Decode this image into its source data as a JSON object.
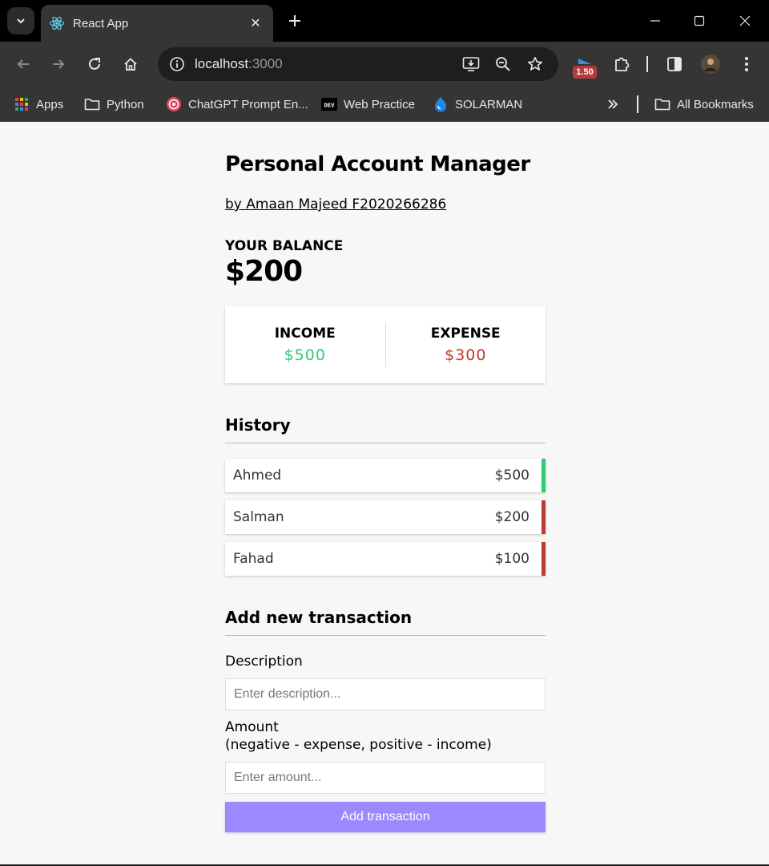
{
  "browser": {
    "tab_title": "React App",
    "url_host": "localhost",
    "url_port": ":3000",
    "extension_badge": "1.50",
    "bookmarks": [
      "Apps",
      "Python",
      "ChatGPT Prompt En...",
      "Web Practice",
      "SOLARMAN"
    ],
    "all_bookmarks": "All Bookmarks"
  },
  "app": {
    "title": "Personal Account Manager",
    "author": "by Amaan Majeed F2020266286",
    "balance_label": "YOUR BALANCE",
    "balance_value": "$200",
    "income_label": "Income",
    "income_value": "$500",
    "expense_label": "Expense",
    "expense_value": "$300",
    "history_title": "History",
    "transactions": [
      {
        "name": "Ahmed",
        "amount": "$500",
        "type": "income"
      },
      {
        "name": "Salman",
        "amount": "$200",
        "type": "expense"
      },
      {
        "name": "Fahad",
        "amount": "$100",
        "type": "expense"
      }
    ],
    "form": {
      "title": "Add new transaction",
      "description_label": "Description",
      "description_placeholder": "Enter description...",
      "amount_label": "Amount",
      "amount_hint": "(negative - expense, positive - income)",
      "amount_placeholder": "Enter amount...",
      "submit_label": "Add transaction"
    }
  },
  "colors": {
    "income": "#2ecc71",
    "expense": "#c0392b",
    "button": "#9c88ff"
  }
}
